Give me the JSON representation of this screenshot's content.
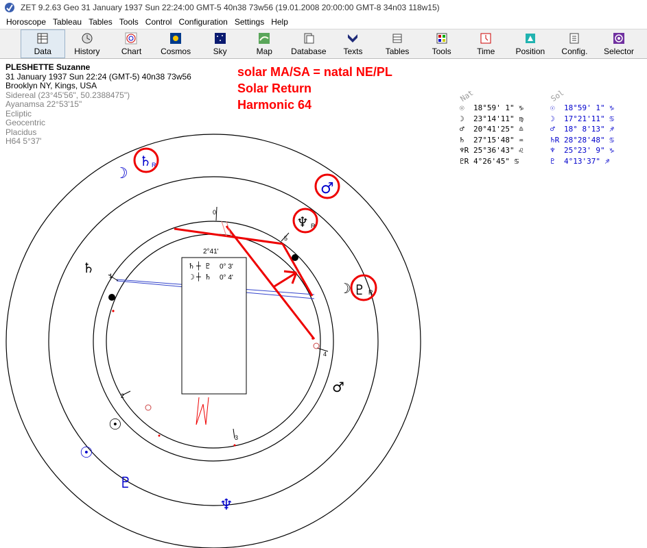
{
  "window": {
    "title": "ZET 9.2.63 Geo   31 January 1937  Sun  22:24:00 GMT-5 40n38  73w56  (19.01.2008  20:00:00 GMT-8 34n03 118w15)"
  },
  "menu": [
    "Horoscope",
    "Tableau",
    "Tables",
    "Tools",
    "Control",
    "Configuration",
    "Settings",
    "Help"
  ],
  "toolbar": [
    {
      "label": "Data",
      "icon": "data-icon"
    },
    {
      "label": "History",
      "icon": "history-icon"
    },
    {
      "label": "Chart",
      "icon": "chart-icon"
    },
    {
      "label": "Cosmos",
      "icon": "cosmos-icon"
    },
    {
      "label": "Sky",
      "icon": "sky-icon"
    },
    {
      "label": "Map",
      "icon": "map-icon"
    },
    {
      "label": "Database",
      "icon": "database-icon"
    },
    {
      "label": "Texts",
      "icon": "texts-icon"
    },
    {
      "label": "Tables",
      "icon": "tables-icon"
    },
    {
      "label": "Tools",
      "icon": "tools-icon"
    },
    {
      "label": "Time",
      "icon": "time-icon"
    },
    {
      "label": "Position",
      "icon": "position-icon"
    },
    {
      "label": "Config.",
      "icon": "config-icon"
    },
    {
      "label": "Selector",
      "icon": "selector-icon"
    }
  ],
  "info": {
    "name": "PLESHETTE Suzanne",
    "datetime": "31 January 1937  Sun  22:24 (GMT-5) 40n38  73w56",
    "place": "Brooklyn NY, Kings, USA",
    "sidereal": "Sidereal (23°45'56\", 50.2388475\")",
    "ayanamsa": "Ayanamsa 22°53'15\"",
    "ecliptic": "Ecliptic",
    "geocentric": "Geocentric",
    "placidus": "Placidus",
    "harmonic": "H64   5°37'"
  },
  "annotation": {
    "line1": "solar MA/SA = natal NE/PL",
    "line2": "Solar Return",
    "line3": "Harmonic 64"
  },
  "positions": {
    "header_nat": "Nat",
    "header_sol": "Sol",
    "rows": [
      {
        "nat_glyph": "☉",
        "nat": "18°59' 1\" ♑",
        "sol_glyph": "☉",
        "sol": "18°59' 1\" ♑"
      },
      {
        "nat_glyph": "☽",
        "nat": "23°14'11\" ♍",
        "sol_glyph": "☽",
        "sol": "17°21'11\" ♋"
      },
      {
        "nat_glyph": "♂",
        "nat": "20°41'25\" ♎",
        "sol_glyph": "♂",
        "sol": "18° 8'13\" ♐"
      },
      {
        "nat_glyph": "♄",
        "nat": "27°15'48\" ♒",
        "sol_glyph": "♄R",
        "sol": "28°28'48\" ♋"
      },
      {
        "nat_glyph": "♆R",
        "nat": "25°36'43\" ♌",
        "sol_glyph": "♆",
        "sol": "25°23' 9\" ♑"
      },
      {
        "nat_glyph": "♇R",
        "nat": " 4°26'45\" ♋",
        "sol_glyph": "♇",
        "sol": " 4°13'37\" ♐"
      }
    ]
  },
  "popup": {
    "row1_a": "♄",
    "row1_b": "♇",
    "row1_val": "0° 3'",
    "row2_a": "☽",
    "row2_b": "♄",
    "row2_val": "0° 4'",
    "arc": "2°41'"
  },
  "house_numbers": [
    "0",
    "5",
    "1",
    "4",
    "2",
    "3"
  ],
  "chart_planets": {
    "outer": [
      {
        "glyph": "☽",
        "color": "#0000cc"
      },
      {
        "glyph": "♄",
        "color": "#0000cc"
      },
      {
        "glyph": "♂",
        "color": "#0000cc"
      },
      {
        "glyph": "♇",
        "color": "#000000"
      },
      {
        "glyph": "☉",
        "color": "#0000cc"
      },
      {
        "glyph": "♇",
        "color": "#0000cc"
      },
      {
        "glyph": "♆",
        "color": "#0000cc"
      }
    ],
    "inner": [
      {
        "glyph": "♆",
        "color": "#000000"
      },
      {
        "glyph": "♄",
        "color": "#000000"
      },
      {
        "glyph": "☽",
        "color": "#000000"
      },
      {
        "glyph": "♂",
        "color": "#000000"
      },
      {
        "glyph": "☉",
        "color": "#000000"
      }
    ],
    "retro_mark": "R"
  },
  "colors": {
    "annotation": "#ff0000",
    "solar": "#0000cc",
    "aspect_line": "#3344cc"
  }
}
